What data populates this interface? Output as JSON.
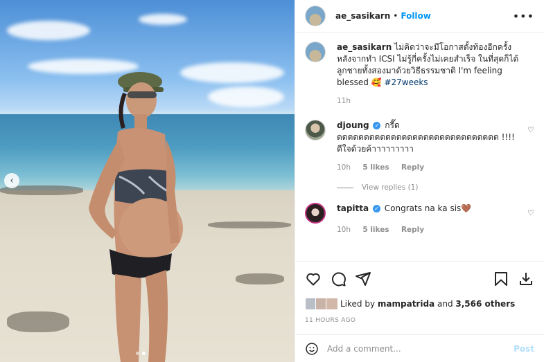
{
  "post": {
    "author": "ae_sasikarn",
    "follow_label": "Follow",
    "separator": "•",
    "more_label": "•••",
    "caption": {
      "username": "ae_sasikarn",
      "text": "ไม่คิดว่าจะมีโอกาสตั้งท้องอีกครั้ง หลังจากทำ ICSI ไม่รู้กี่ครั้งไม่เคยสำเร็จ ในที่สุดก็ได้ลูกชายทั้งสองมาด้วยวิธีธรรมชาติ I'm feeling blessed",
      "emoji": "🥰",
      "hashtag": "#27weeks",
      "time": "11h"
    }
  },
  "comments": [
    {
      "username": "djoung",
      "verified_mark": "✓",
      "text": "กรี๊ดดดดดดดดดดดดดดดดดดดดดดดดดดดดดดด !!!! ดีใจด้วยค้าาาาาาาาา",
      "time": "10h",
      "likes": "5 likes",
      "reply": "Reply",
      "view_replies": "View replies (1)"
    },
    {
      "username": "tapitta",
      "verified_mark": "✓",
      "text": "Congrats na ka sis🤎",
      "time": "10h",
      "likes": "5 likes",
      "reply": "Reply"
    }
  ],
  "likes": {
    "prefix": "Liked by",
    "user": "mampatrida",
    "conj": "and",
    "count": "3,566 others"
  },
  "timestamp": "11 HOURS AGO",
  "add_comment": {
    "placeholder": "Add a comment...",
    "post_label": "Post"
  },
  "icons": {
    "heart": "heart-icon",
    "comment": "comment-icon",
    "share": "share-icon",
    "save": "bookmark-icon",
    "download": "download-icon",
    "emoji": "emoji-icon",
    "arrow": "chevron-left-icon",
    "more": "more-icon"
  },
  "colors": {
    "accent": "#0095f6",
    "hashtag": "#00376b",
    "muted": "#8e8e8e",
    "verified": "#3897f0"
  },
  "carousel": {
    "total": 2,
    "active": 2
  }
}
